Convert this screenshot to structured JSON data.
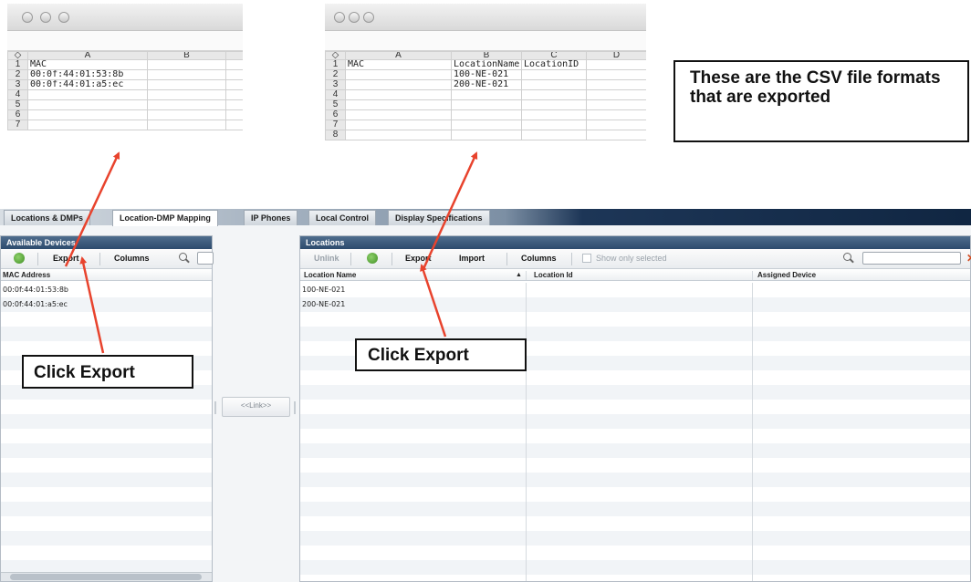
{
  "spreadsheet_left": {
    "col_headers": [
      "A",
      "B"
    ],
    "rows": [
      {
        "num": "1",
        "a": "MAC",
        "b": ""
      },
      {
        "num": "2",
        "a": "00:0f:44:01:53:8b",
        "b": ""
      },
      {
        "num": "3",
        "a": "00:0f:44:01:a5:ec",
        "b": ""
      },
      {
        "num": "4",
        "a": "",
        "b": ""
      },
      {
        "num": "5",
        "a": "",
        "b": ""
      },
      {
        "num": "6",
        "a": "",
        "b": ""
      },
      {
        "num": "7",
        "a": "",
        "b": ""
      }
    ]
  },
  "spreadsheet_right": {
    "col_headers": [
      "A",
      "B",
      "C",
      "D"
    ],
    "rows": [
      {
        "num": "1",
        "a": "MAC",
        "b": "LocationName",
        "c": "LocationID",
        "d": ""
      },
      {
        "num": "2",
        "a": "",
        "b": "100-NE-021",
        "c": "",
        "d": ""
      },
      {
        "num": "3",
        "a": "",
        "b": "200-NE-021",
        "c": "",
        "d": ""
      },
      {
        "num": "4",
        "a": "",
        "b": "",
        "c": "",
        "d": ""
      },
      {
        "num": "5",
        "a": "",
        "b": "",
        "c": "",
        "d": ""
      },
      {
        "num": "6",
        "a": "",
        "b": "",
        "c": "",
        "d": ""
      },
      {
        "num": "7",
        "a": "",
        "b": "",
        "c": "",
        "d": ""
      },
      {
        "num": "8",
        "a": "",
        "b": "",
        "c": "",
        "d": ""
      }
    ]
  },
  "callouts": {
    "csv_note": "These are the CSV file formats that are exported",
    "click_export_left": "Click Export",
    "click_export_right": "Click Export"
  },
  "tabs": [
    {
      "label": "Locations & DMPs",
      "active": false
    },
    {
      "label": "Location-DMP Mapping",
      "active": true
    },
    {
      "label": "IP Phones",
      "active": false
    },
    {
      "label": "Local Control",
      "active": false
    },
    {
      "label": "Display Specifications",
      "active": false
    }
  ],
  "available_devices": {
    "title": "Available Devices",
    "toolbar": {
      "export": "Export",
      "columns": "Columns"
    },
    "column": "MAC Address",
    "rows": [
      "00:0f:44:01:53:8b",
      "00:0f:44:01:a5:ec"
    ]
  },
  "link_button": "<<Link>>",
  "locations": {
    "title": "Locations",
    "toolbar": {
      "unlink": "Unlink",
      "export": "Export",
      "import": "Import",
      "columns": "Columns",
      "show_only_selected": "Show only selected"
    },
    "columns": [
      "Location Name",
      "Location Id",
      "Assigned Device"
    ],
    "sort_indicator": "▲",
    "rows": [
      {
        "name": "100-NE-021",
        "id": "",
        "device": ""
      },
      {
        "name": "200-NE-021",
        "id": "",
        "device": ""
      }
    ]
  },
  "colors": {
    "arrow": "#e8432d",
    "panel_header": "#3a5879",
    "tabbar_dark": "#102642",
    "close_x": "#d24a1f"
  },
  "icons": [
    "refresh-icon",
    "search-icon",
    "close-icon",
    "sort-ascending-icon",
    "window-button-icon"
  ]
}
